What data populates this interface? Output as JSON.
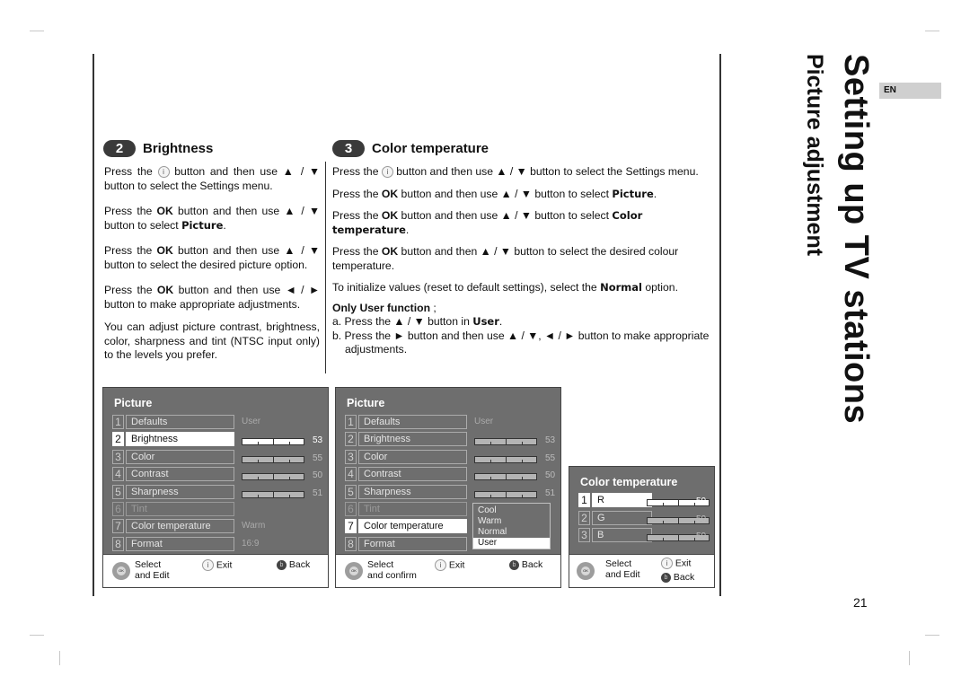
{
  "lang_tab": "EN",
  "page_title": "Setting up TV stations",
  "page_subtitle": "Picture adjustment",
  "page_number": "21",
  "brightness": {
    "step": "2",
    "title": "Brightness",
    "p1_a": "Press the",
    "p1_icon": "i",
    "p1_b": "button and then use ▲ / ▼ button to select the Settings menu.",
    "p2_a": "Press the",
    "p2_ok": "OK",
    "p2_b": "button and then use ▲ / ▼ button to select",
    "p2_kw": "Picture",
    "p2_c": ".",
    "p3_a": "Press the",
    "p3_ok": "OK",
    "p3_b": "button and then use ▲ / ▼ button to select the desired picture option.",
    "p4_a": "Press the",
    "p4_ok": "OK",
    "p4_b": "button and then use ◄ / ► button to make appropriate adjustments.",
    "p5": "You can adjust picture contrast, brightness, color, sharpness and tint (NTSC input only) to the levels you prefer."
  },
  "color_temp": {
    "step": "3",
    "title": "Color temperature",
    "p1_a": "Press the",
    "p1_icon": "i",
    "p1_b": "button and then use ▲ / ▼ button to select the Settings menu.",
    "p2_a": "Press the",
    "p2_ok": "OK",
    "p2_b": "button and then use ▲ / ▼ button to select",
    "p2_kw": "Picture",
    "p2_c": ".",
    "p3_a": "Press the",
    "p3_ok": "OK",
    "p3_b": "button and then use ▲ / ▼ button to select",
    "p3_kw": "Color temperature",
    "p3_c": ".",
    "p4_a": "Press the",
    "p4_ok": "OK",
    "p4_b": "button and then ▲ / ▼ button to select the desired colour temperature.",
    "p5_a": "To initialize values (reset to default settings), select the",
    "p5_kw": "Normal",
    "p5_b": "option.",
    "user_head": "Only User function",
    "user_head_tail": " ;",
    "a_a": "a. Press the ▲ / ▼ button in",
    "a_kw": "User",
    "a_b": ".",
    "b": "b. Press the ► button and then use ▲ / ▼, ◄ / ► button to make appropriate adjustments."
  },
  "menu1": {
    "title": "Picture",
    "items": [
      {
        "num": "1",
        "label": "Defaults",
        "value": "User"
      },
      {
        "num": "2",
        "label": "Brightness",
        "level": 53
      },
      {
        "num": "3",
        "label": "Color",
        "level": 55
      },
      {
        "num": "4",
        "label": "Contrast",
        "level": 50
      },
      {
        "num": "5",
        "label": "Sharpness",
        "level": 51
      },
      {
        "num": "6",
        "label": "Tint"
      },
      {
        "num": "7",
        "label": "Color temperature",
        "value": "Warm"
      },
      {
        "num": "8",
        "label": "Format",
        "value": "16:9"
      }
    ],
    "selected": "Brightness",
    "footer": {
      "select": "Select",
      "select2": "and Edit",
      "exit": "Exit",
      "back": "Back"
    }
  },
  "menu2": {
    "title": "Picture",
    "items": [
      {
        "num": "1",
        "label": "Defaults",
        "value": "User"
      },
      {
        "num": "2",
        "label": "Brightness",
        "level": 53
      },
      {
        "num": "3",
        "label": "Color",
        "level": 55
      },
      {
        "num": "4",
        "label": "Contrast",
        "level": 50
      },
      {
        "num": "5",
        "label": "Sharpness",
        "level": 51
      },
      {
        "num": "6",
        "label": "Tint"
      },
      {
        "num": "7",
        "label": "Color temperature"
      },
      {
        "num": "8",
        "label": "Format"
      }
    ],
    "selected": "Color temperature",
    "dropdown": [
      "Cool",
      "Warm",
      "Normal",
      "User"
    ],
    "dropdown_selected": "User",
    "footer": {
      "select": "Select",
      "select2": "and confirm",
      "exit": "Exit",
      "back": "Back"
    }
  },
  "menu3": {
    "title": "Color temperature",
    "items": [
      {
        "num": "1",
        "label": "R",
        "level": 50
      },
      {
        "num": "2",
        "label": "G",
        "level": 50
      },
      {
        "num": "3",
        "label": "B",
        "level": 50
      }
    ],
    "selected": "R",
    "footer": {
      "select": "Select",
      "select2": "and Edit",
      "exit": "Exit",
      "back": "Back"
    }
  },
  "icons": {
    "ok_label": "OK",
    "info": "i",
    "back": "b"
  }
}
